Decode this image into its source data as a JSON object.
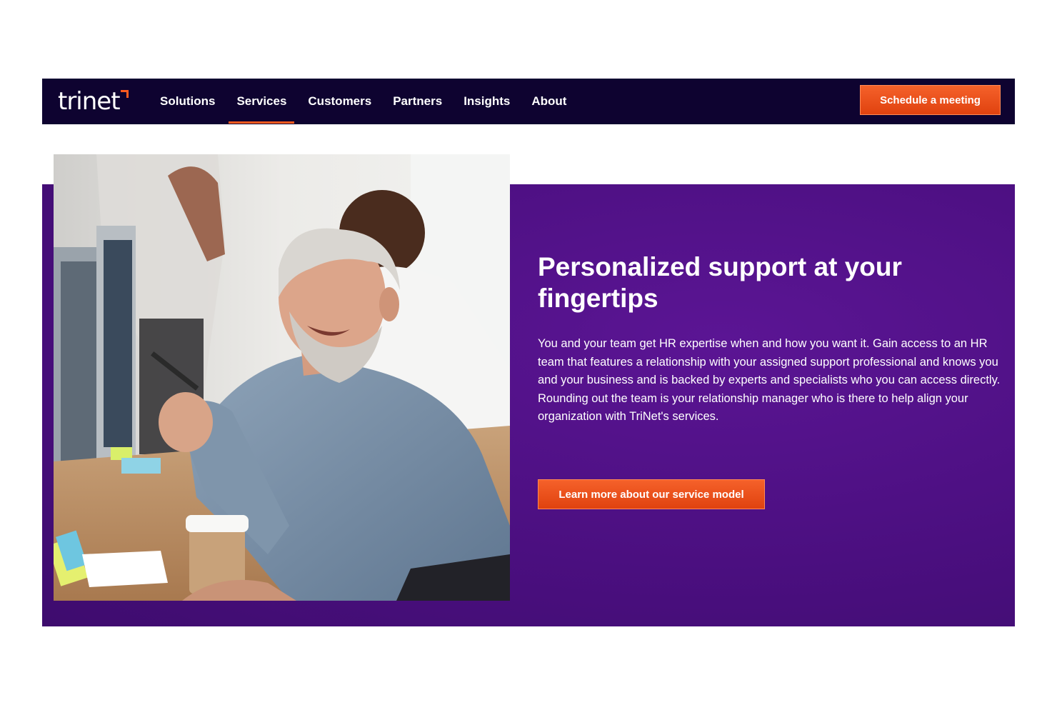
{
  "brand": {
    "logo_text": "trinet",
    "accent_color": "#ff5b1f",
    "nav_background": "#0e0330",
    "hero_background": "#4b0f80"
  },
  "nav": {
    "items": [
      {
        "label": "Solutions",
        "active": false
      },
      {
        "label": "Services",
        "active": true
      },
      {
        "label": "Customers",
        "active": false
      },
      {
        "label": "Partners",
        "active": false
      },
      {
        "label": "Insights",
        "active": false
      },
      {
        "label": "About",
        "active": false
      }
    ],
    "cta_label": "Schedule a meeting"
  },
  "hero": {
    "title": "Personalized support at your fingertips",
    "body": "You and your team get HR expertise when and how you want it. Gain access to an HR team that features a relationship with your assigned support professional and knows you and your business and is backed by experts and specialists who you can access directly. Rounding out the team is your relationship manager who is there to help align your organization with TriNet's services.",
    "cta_label": "Learn more about our service model"
  }
}
